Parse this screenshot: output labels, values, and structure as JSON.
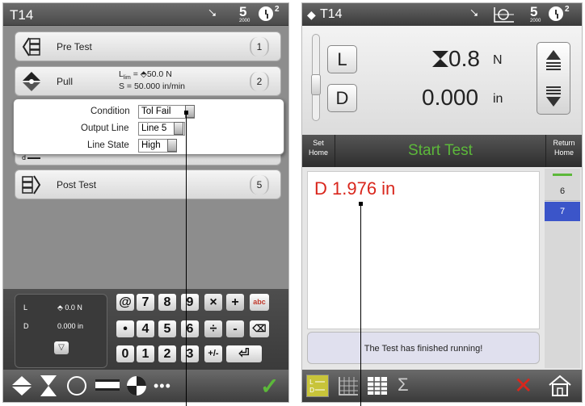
{
  "left_screen": {
    "title": "T14",
    "five_sub": "2000",
    "badge": "2",
    "steps": [
      {
        "label": "Pre Test",
        "num": "1"
      },
      {
        "label": "Pull",
        "num": "2",
        "line1": "L",
        "line1_sub": "lim",
        "line1_rest": " = ⬘50.0 N",
        "line2": "S = 50.000 in/min"
      },
      {
        "label": "",
        "num": ""
      },
      {
        "label": "",
        "num": ""
      },
      {
        "label": "Post Test",
        "num": "5"
      }
    ],
    "popup": {
      "condition_label": "Condition",
      "condition_value": "Tol Fail",
      "output_label": "Output Line",
      "output_value": "Line 5",
      "state_label": "Line State",
      "state_value": "High"
    },
    "mini": {
      "l_label": "L",
      "l_value": "⬘ 0.0 N",
      "d_label": "D",
      "d_value": "0.000 in"
    },
    "keys": [
      "@",
      "7",
      "8",
      "9",
      "×",
      "+",
      "abc",
      "•",
      "4",
      "5",
      "6",
      "÷",
      "-",
      "⌫",
      "0",
      "1",
      "2",
      "3",
      "+/-",
      "⏎"
    ],
    "bottom_more": "•••"
  },
  "right_screen": {
    "title": "T14",
    "five_sub": "2000",
    "badge": "2",
    "l_button": "L",
    "d_button": "D",
    "load_value": "0.8",
    "load_unit": "N",
    "pos_value": "0.000",
    "pos_unit": "in",
    "set_home": [
      "Set",
      "Home"
    ],
    "start_test": "Start Test",
    "return_home": [
      "Return",
      "Home"
    ],
    "result_text": "D 1.976 in",
    "finished_text": "The Test has finished running!",
    "side_items": [
      "6",
      "7"
    ],
    "sigma": "Σ",
    "colors": {
      "accent_green": "#5cb83a",
      "red": "#d9261c",
      "blue": "#3b55c9"
    }
  }
}
